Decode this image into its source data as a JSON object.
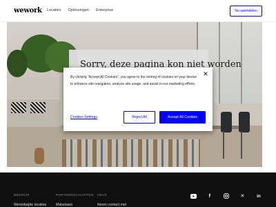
{
  "header": {
    "logo": "wework",
    "nav": [
      "Locaties",
      "Oplossingen",
      "Enterprise"
    ],
    "login_label": "Nu aanmelden"
  },
  "hero": {
    "error_title": "Sorry, deze pagina kon niet worden"
  },
  "cookie_dialog": {
    "text": "By clicking “Accept All Cookies”, you agree to the storing of cookies on your device to enhance site navigation, analyze site usage, and assist in our marketing efforts.",
    "close_icon": "close-icon",
    "settings_label": "Cookies Settings",
    "reject_label": "Reject All",
    "accept_label": "Accept All Cookies",
    "accent_color": "#0000ff"
  },
  "footer": {
    "columns": [
      {
        "heading": "BEDRIJF",
        "link": "Wereldwijde locaties"
      },
      {
        "heading": "PARTNERSCHAPPEN",
        "link": "Makelaars"
      },
      {
        "heading": "HELP",
        "link": "Neem contact met"
      }
    ],
    "socials": [
      "youtube-icon",
      "facebook-icon",
      "instagram-icon",
      "x-icon",
      "linkedin-icon"
    ]
  }
}
